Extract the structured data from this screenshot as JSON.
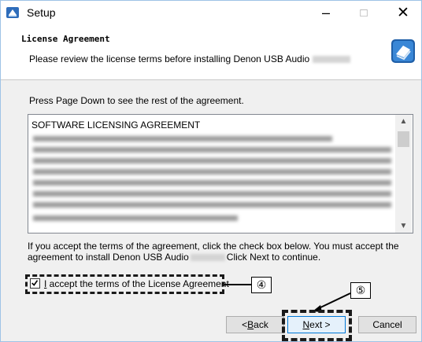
{
  "window": {
    "title": "Setup"
  },
  "window_controls": {
    "minimize": "–",
    "maximize": "□",
    "close": "✕"
  },
  "header": {
    "title": "License Agreement",
    "subtitle": "Please review the license terms before installing Denon USB Audio"
  },
  "body": {
    "prompt": "Press Page Down to see the rest of the agreement.",
    "license_heading": "SOFTWARE LICENSING AGREEMENT",
    "info_part1": "If you accept the terms of the agreement, click the check box below. You must accept the agreement to install Denon USB Audio",
    "info_part2": "Click Next to continue."
  },
  "checkbox": {
    "label_accel": "I",
    "label_rest": " accept the terms of the License Agreement",
    "checked": true
  },
  "callouts": {
    "four": "④",
    "five": "⑤"
  },
  "buttons": {
    "back_accel": "B",
    "back_prefix": "< ",
    "back_rest": "ack",
    "next_accel": "N",
    "next_rest": "ext >",
    "cancel": "Cancel"
  },
  "icons": {
    "app": "setup-app-icon",
    "installer": "installer-icon"
  },
  "colors": {
    "accent": "#0078d7",
    "title_bg": "#ffffff",
    "body_bg": "#f0f0f0"
  }
}
